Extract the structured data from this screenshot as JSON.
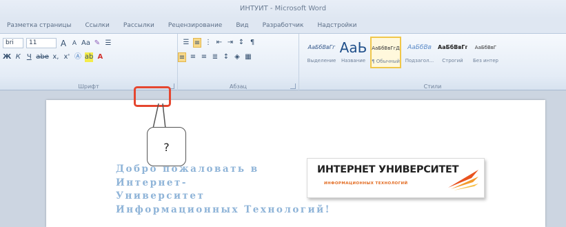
{
  "window": {
    "title": "ИНТУИТ - Microsoft Word"
  },
  "tabs": [
    "Разметка страницы",
    "Ссылки",
    "Рассылки",
    "Рецензирование",
    "Вид",
    "Разработчик",
    "Надстройки"
  ],
  "font_group": {
    "label": "Шрифт",
    "font_name": "bri",
    "font_size": "11",
    "grow": "A",
    "shrink": "A",
    "case": "Aa",
    "bold": "Ж",
    "italic": "К",
    "underline": "Ч",
    "strike": "abe",
    "subscript": "x,",
    "superscript": "x'",
    "font_color": "A",
    "highlight_color": "ab"
  },
  "paragraph_group": {
    "label": "Абзац",
    "pilcrow": "¶",
    "sort": "↕"
  },
  "styles_group": {
    "label": "Стили",
    "items": [
      {
        "sample": "АаБбВвГг",
        "name": "Выделение",
        "active": false
      },
      {
        "sample": "АаЬ",
        "name": "Название",
        "active": false
      },
      {
        "sample": "АаБбВвГгД",
        "name": "¶ Обычный",
        "active": true
      },
      {
        "sample": "АаБбВв",
        "name": "Подзагол...",
        "active": false
      },
      {
        "sample": "АаБбВвГг",
        "name": "Строгий",
        "active": false
      },
      {
        "sample": "АаБбВвГ",
        "name": "Без интер",
        "active": false
      }
    ]
  },
  "callout": {
    "text": "?"
  },
  "document": {
    "welcome_lines": [
      "Добро пожаловать в",
      "Интернет-",
      "Университет",
      "Информационных Технологий!"
    ],
    "logo_title": "ИНТЕРНЕТ УНИВЕРСИТЕТ",
    "logo_subtitle": "ИНФОРМАЦИОННЫХ ТЕХНОЛОГИЙ"
  },
  "colors": {
    "highlight": "#e5462f",
    "welcome_text": "#8fb4d8",
    "logo_accent": "#e26a1f"
  }
}
